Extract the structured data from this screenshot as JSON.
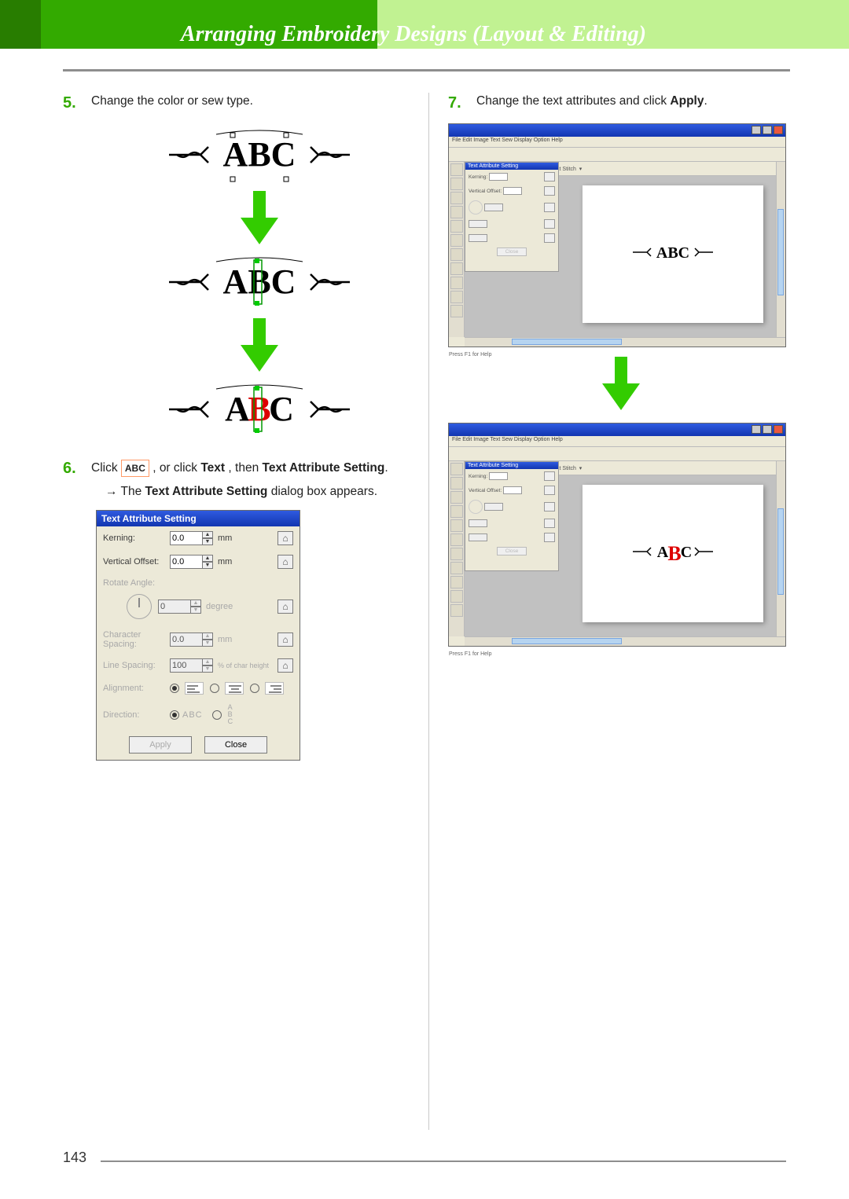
{
  "header": {
    "title": "Arranging Embroidery Designs (Layout & Editing)"
  },
  "steps": {
    "s5": {
      "num": "5.",
      "text": "Change the color or sew type."
    },
    "s6": {
      "num": "6.",
      "click_word": "Click ",
      "or_click": " , or click ",
      "text_menu": "Text",
      "then": ", then ",
      "text_attr_setting": "Text Attribute Setting",
      "period": ".",
      "arrow_line_prefix": "→ The ",
      "tas_bold": "Text Attribute Setting",
      "arrow_line_suffix": " dialog box appears."
    },
    "s7": {
      "num": "7.",
      "text_prefix": "Change the text attributes and click ",
      "apply_bold": "Apply",
      "text_suffix": "."
    }
  },
  "abc_icon_label": "ABC",
  "dialog": {
    "title": "Text Attribute Setting",
    "rows": {
      "kerning": {
        "label": "Kerning:",
        "value": "0.0",
        "unit": "mm"
      },
      "voff": {
        "label": "Vertical Offset:",
        "value": "0.0",
        "unit": "mm"
      },
      "rotate": {
        "label": "Rotate Angle:",
        "value": "0",
        "unit": "degree"
      },
      "charsp": {
        "label": "Character Spacing:",
        "value": "0.0",
        "unit": "mm"
      },
      "linesp": {
        "label": "Line Spacing:",
        "value": "100",
        "unit": "% of char height"
      },
      "align": {
        "label": "Alignment:"
      },
      "dir": {
        "label": "Direction:",
        "horiz": "ABC",
        "vert": "A\nB\nC"
      }
    },
    "buttons": {
      "apply": "Apply",
      "close": "Close"
    }
  },
  "appshot": {
    "panel_title": "Text Attribute Setting",
    "panel_row1": "Kerning:",
    "panel_row2": "Vertical Offset:",
    "menu_items": "File  Edit  Image  Text  Sew  Display  Option  Help",
    "close_btn": "Close",
    "status": "Press F1 for Help",
    "toolbar2_label": "Direct Stitch"
  },
  "page_number": "143"
}
